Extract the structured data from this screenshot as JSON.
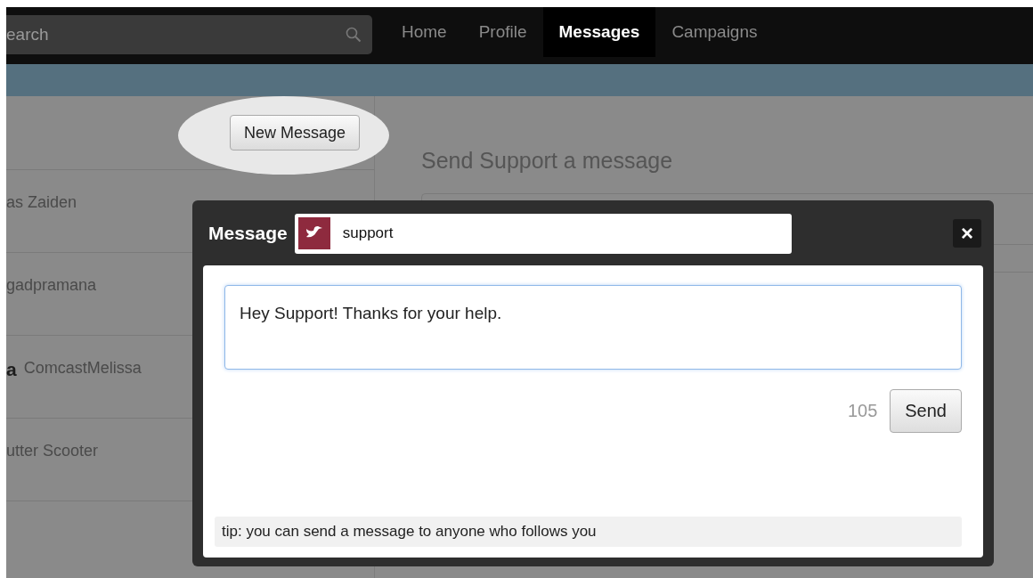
{
  "search": {
    "value": "earch"
  },
  "nav": [
    {
      "label": "Home",
      "selected": false
    },
    {
      "label": "Profile",
      "selected": false
    },
    {
      "label": "Messages",
      "selected": true
    },
    {
      "label": "Campaigns",
      "selected": false
    }
  ],
  "new_message_button": "New Message",
  "conversations": [
    {
      "handle": "as Zaiden"
    },
    {
      "handle": "gadpramana"
    },
    {
      "name": "a",
      "handle": "ComcastMelissa"
    },
    {
      "handle": "utter Scooter"
    }
  ],
  "compose": {
    "heading": "Send Support a message"
  },
  "dialog": {
    "title": "Message",
    "recipient": "support",
    "close_label": "×",
    "message": "Hey Support! Thanks for your help.",
    "remaining": "105",
    "send_button": "Send",
    "tip": "tip: you can send a message to anyone who follows you"
  }
}
